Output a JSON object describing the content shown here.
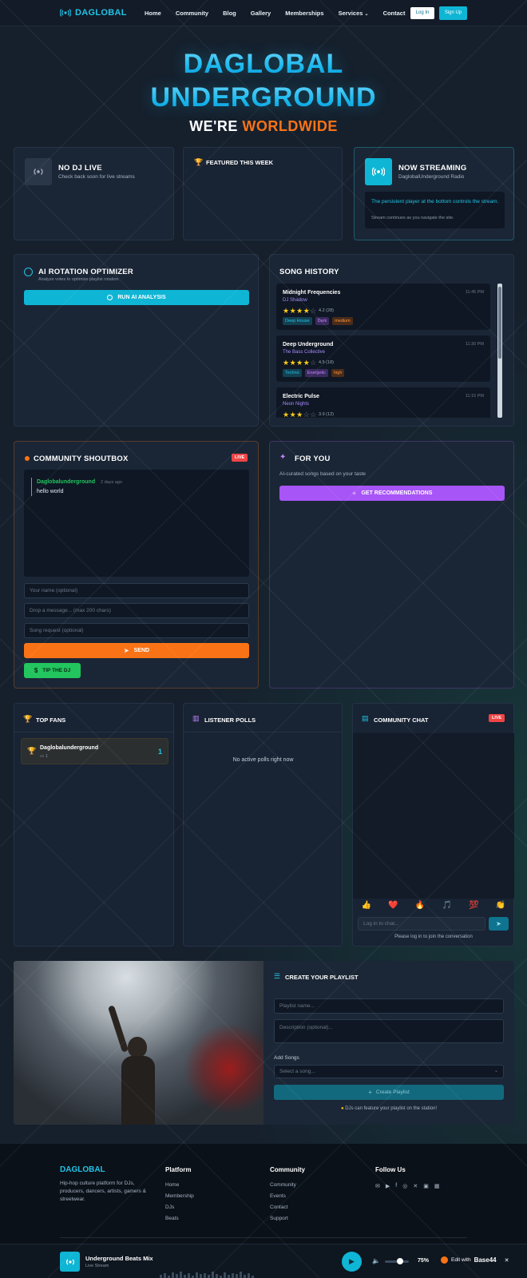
{
  "nav": {
    "brand": "DAGLOBAL",
    "links": [
      "Home",
      "Community",
      "Blog",
      "Gallery",
      "Memberships",
      "Services",
      "Contact"
    ],
    "login": "Log In",
    "signup": "Sign Up"
  },
  "hero": {
    "line1": "DAGLOBAL",
    "line2": "UNDERGROUND",
    "tagline_a": "WE'RE",
    "tagline_b": "WORLDWIDE"
  },
  "no_dj": {
    "title": "NO DJ LIVE",
    "subtitle": "Check back soon for live streams"
  },
  "featured": {
    "title": "FEATURED THIS WEEK"
  },
  "streaming": {
    "title": "NOW STREAMING",
    "subtitle": "DaglobalUnderground Radio",
    "note1": "The persistent player at the bottom controls the stream.",
    "note2": "Stream continues as you navigate the site."
  },
  "ai": {
    "title": "AI ROTATION OPTIMIZER",
    "subtitle": "Analyze votes to optimize playlist rotation",
    "button": "RUN AI ANALYSIS"
  },
  "history": {
    "title": "SONG HISTORY",
    "songs": [
      {
        "name": "Midnight Frequencies",
        "artist": "DJ Shadow",
        "time": "11:45 PM",
        "rating": "4.2 (28)",
        "tags": [
          "Deep House",
          "Dark",
          "medium"
        ]
      },
      {
        "name": "Deep Underground",
        "artist": "The Bass Collective",
        "time": "11:30 PM",
        "rating": "4.5 (18)",
        "tags": [
          "Techno",
          "Energetic",
          "high"
        ]
      },
      {
        "name": "Electric Pulse",
        "artist": "Neon Nights",
        "time": "11:15 PM",
        "rating": "3.9 (12)",
        "tags": []
      }
    ]
  },
  "shoutbox": {
    "title": "COMMUNITY SHOUTBOX",
    "live": "LIVE",
    "msg_user": "Daglobalunderground",
    "msg_time": "2 days ago",
    "msg_text": "hello world",
    "name_ph": "Your name (optional)",
    "msg_ph": "Drop a message... (max 200 chars)",
    "req_ph": "Song request (optional)",
    "send": "SEND",
    "tip": "TIP THE DJ"
  },
  "foryou": {
    "title": "FOR YOU",
    "subtitle": "AI-curated songs based on your taste",
    "button": "GET RECOMMENDATIONS"
  },
  "fans": {
    "title": "TOP FANS",
    "name": "Daglobalunderground",
    "count": "1",
    "sub": "1"
  },
  "polls": {
    "title": "LISTENER POLLS",
    "empty": "No active polls right now"
  },
  "chat": {
    "title": "COMMUNITY CHAT",
    "live": "LIVE",
    "emojis": [
      "👍",
      "❤️",
      "🔥",
      "🎵",
      "💯",
      "👏"
    ],
    "input_ph": "Log in to chat...",
    "note": "Please log in to join the conversation"
  },
  "playlist": {
    "title": "CREATE YOUR PLAYLIST",
    "name_ph": "Playlist name...",
    "desc_ph": "Description (optional)...",
    "add_label": "Add Songs",
    "select_ph": "Select a song...",
    "button": "Create Playlist",
    "note": "DJs can feature your playlist on the station!"
  },
  "footer": {
    "brand": "DAGLOBAL",
    "about": "Hip-hop culture platform for DJs, producers, dancers, artists, gamers & streetwear.",
    "platform_h": "Platform",
    "platform": [
      "Home",
      "Membership",
      "DJs",
      "Beats"
    ],
    "community_h": "Community",
    "community": [
      "Community",
      "Events",
      "Contact",
      "Support"
    ],
    "follow_h": "Follow Us"
  },
  "player": {
    "title": "Underground Beats Mix",
    "sub": "Live Stream",
    "volume": "75%",
    "edit_a": "Edit with",
    "edit_b": "Base44"
  },
  "colors": {
    "accent": "#0fb5d4",
    "orange": "#f97316",
    "purple": "#a855f7",
    "green": "#22c55e",
    "live_red": "#ef4444"
  }
}
